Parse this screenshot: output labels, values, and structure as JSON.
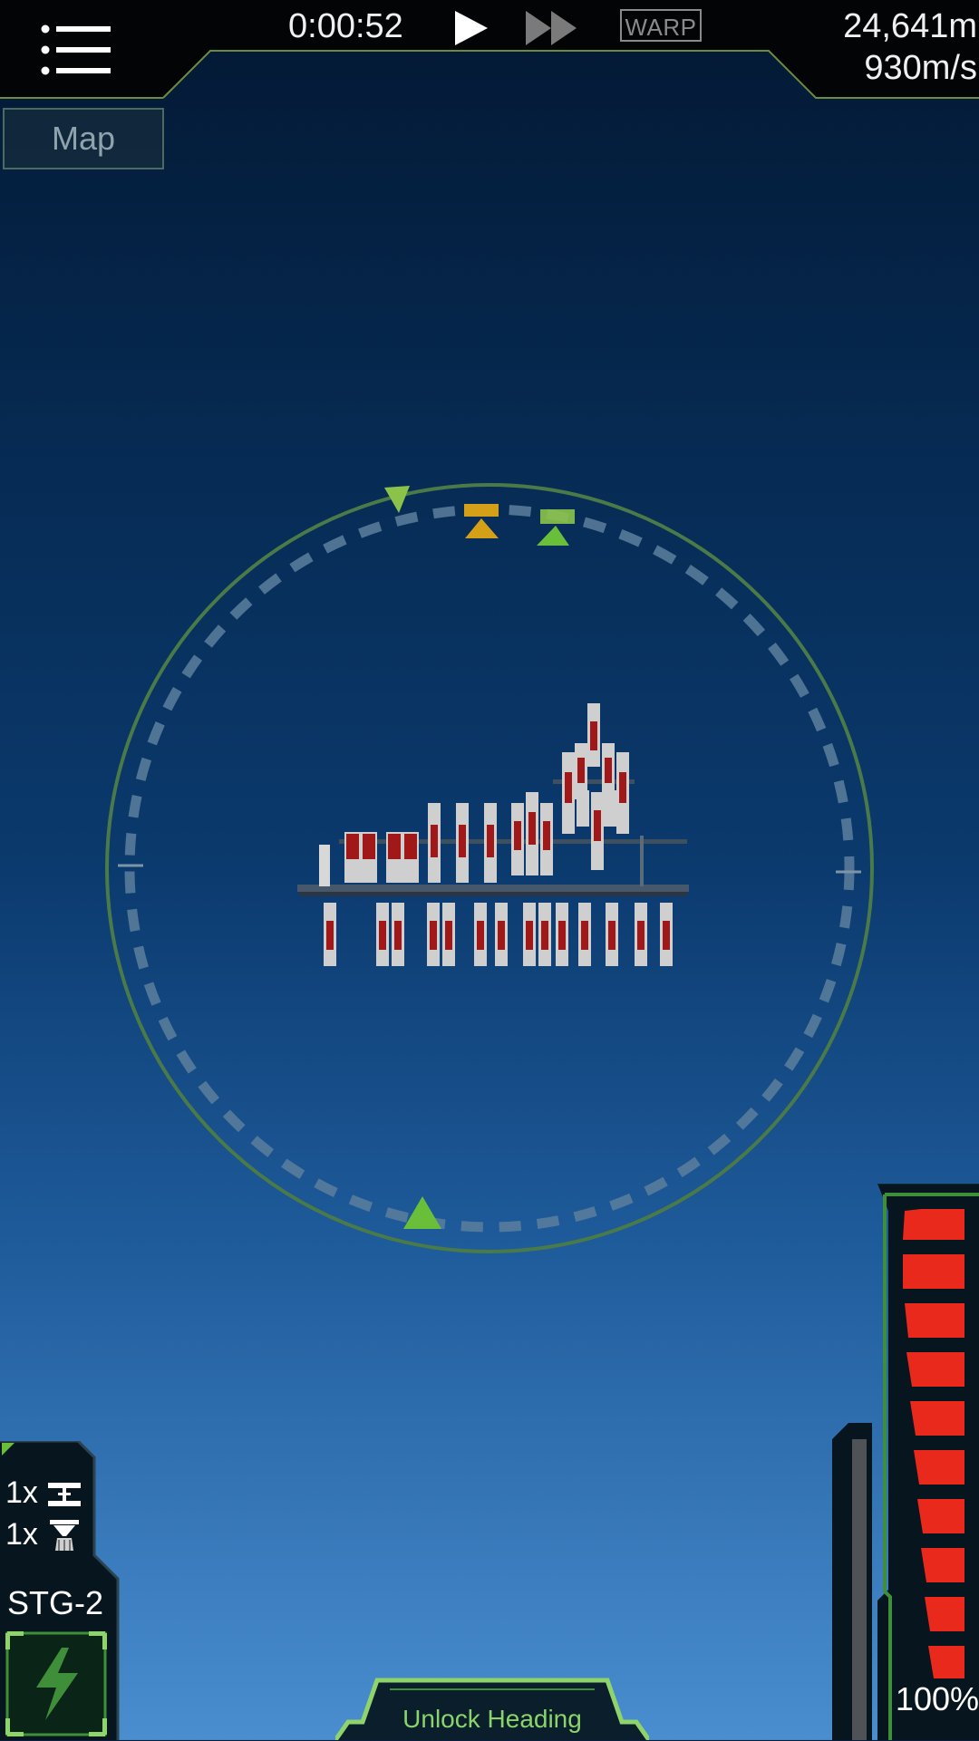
{
  "hud": {
    "timer": "0:00:52",
    "warp_label": "WARP",
    "altitude": "24,641m",
    "velocity": "930m/s",
    "map_label": "Map"
  },
  "throttle": {
    "percent_label": "100%",
    "level": 1.0
  },
  "stage": {
    "parachute_count": "1x",
    "engine_count": "1x",
    "stage_name": "STG-2"
  },
  "bottom": {
    "unlock_heading_label": "Unlock Heading"
  },
  "icons": {
    "menu": "menu-list-icon",
    "play": "play-icon",
    "fast_forward": "fast-forward-icon",
    "launch": "lightning-icon",
    "separator": "separator-icon",
    "engine": "engine-icon"
  },
  "colors": {
    "frame_green": "#8fd46a",
    "heading_marker": "#d4a017",
    "nav_ring": "#4d7a4a",
    "throttle_red": "#e8291c"
  }
}
